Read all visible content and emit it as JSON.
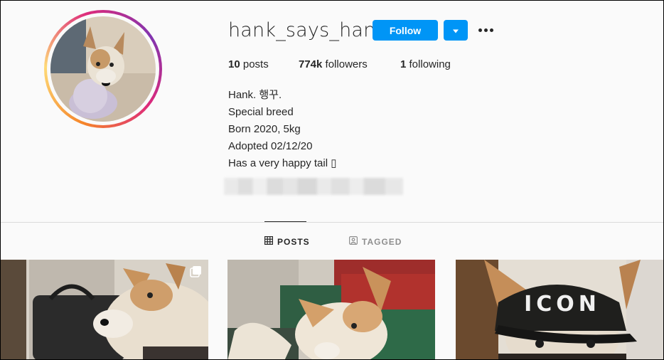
{
  "profile": {
    "username": "hank_says_hank",
    "follow_label": "Follow",
    "stats": {
      "posts_count": "10",
      "posts_label": "posts",
      "followers_count": "774k",
      "followers_label": "followers",
      "following_count": "1",
      "following_label": "following"
    },
    "bio": [
      "Hank. 행꾸.",
      "Special breed",
      "Born 2020, 5kg",
      "Adopted 02/12/20",
      "Has a very happy tail ▯"
    ]
  },
  "tabs": [
    {
      "label": "POSTS",
      "icon": "grid-icon",
      "active": true
    },
    {
      "label": "TAGGED",
      "icon": "tag-person-icon",
      "active": false
    }
  ],
  "grid": {
    "posts": [
      {
        "description_icon": "multi-photo-icon"
      },
      {},
      {
        "cap_text": "ICON"
      }
    ]
  },
  "colors": {
    "accent": "#0095f6",
    "divider": "#dbdbdb",
    "muted": "#8e8e8e"
  }
}
